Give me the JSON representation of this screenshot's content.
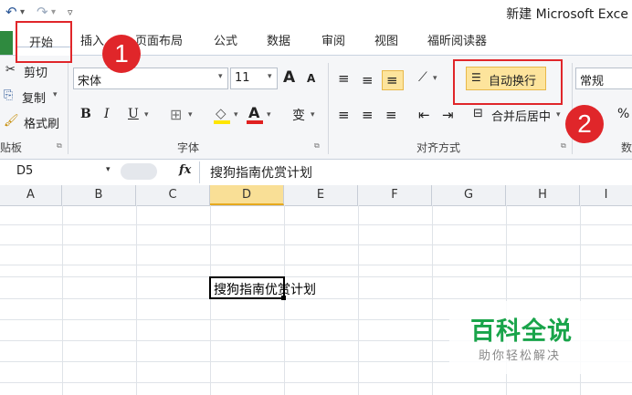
{
  "window": {
    "title": "新建 Microsoft Exce"
  },
  "qat": {
    "undo_icon": "undo-icon",
    "redo_icon": "redo-icon",
    "customize_icon": "qat-customize-icon"
  },
  "tabs": [
    "开始",
    "插入",
    "页面布局",
    "公式",
    "数据",
    "审阅",
    "视图",
    "福昕阅读器"
  ],
  "clipboard": {
    "cut": "剪切",
    "copy": "复制",
    "format_painter": "格式刷",
    "group": "贴板"
  },
  "font": {
    "name": "宋体",
    "size": "11",
    "group": "字体",
    "grow_label": "A",
    "shrink_label": "A",
    "bold": "B",
    "italic": "I",
    "underline": "U",
    "font_color_label": "A",
    "wen_label": "变"
  },
  "alignment": {
    "wrap_text": "自动换行",
    "merge_center": "合并后居中",
    "group": "对齐方式"
  },
  "number": {
    "format": "常规",
    "percent": "%",
    "group_partial": "数"
  },
  "formula_bar": {
    "name_box": "D5",
    "fx": "fx",
    "content": "搜狗指南优赏计划"
  },
  "grid": {
    "columns": [
      "A",
      "B",
      "C",
      "D",
      "E",
      "F",
      "G",
      "H",
      "I"
    ],
    "active_cell": "D5",
    "cell_text": "搜狗指南优赏计划"
  },
  "annotations": {
    "step1": "1",
    "step2": "2"
  },
  "watermark": {
    "title": "百科全说",
    "subtitle": "助你轻松解决"
  },
  "colors": {
    "accent_red": "#e0262a",
    "file_green": "#2f8a3f",
    "selected_col": "#f7e3a1",
    "watermark_green": "#19a44a"
  }
}
